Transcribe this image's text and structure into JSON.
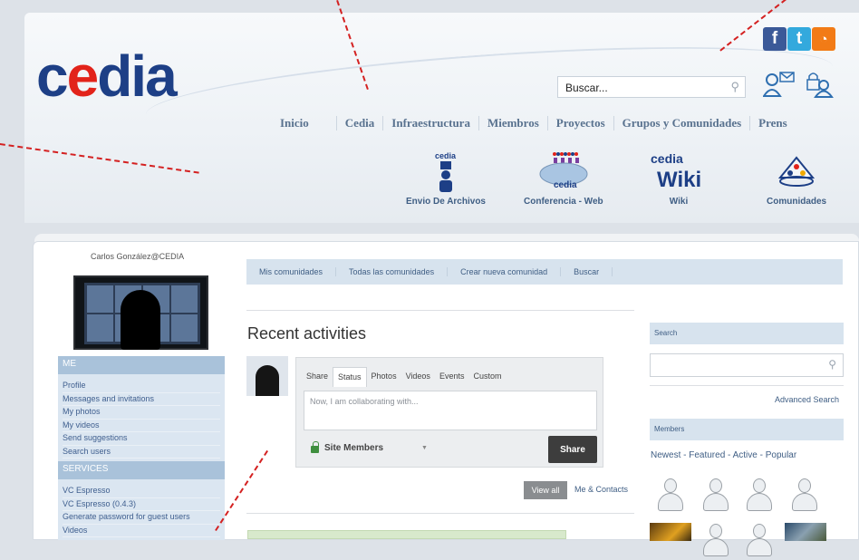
{
  "header": {
    "logo_pre": "c",
    "logo_e": "e",
    "logo_post": "dia",
    "social": [
      {
        "icon": "facebook-icon",
        "glyph": "f"
      },
      {
        "icon": "twitter-icon",
        "glyph": "t"
      },
      {
        "icon": "rss-icon",
        "glyph": "◔"
      }
    ],
    "search_placeholder": "Buscar...",
    "nav": [
      "Inicio",
      "Cedia",
      "Infraestructura",
      "Miembros",
      "Proyectos",
      "Grupos y Comunidades",
      "Prens"
    ]
  },
  "services": [
    {
      "icon": "file-transfer-icon",
      "label": "Envio De Archivos"
    },
    {
      "icon": "web-conference-icon",
      "label": "Conferencia - Web",
      "sub": "cedia"
    },
    {
      "icon": "wiki-icon",
      "label": "Wiki",
      "logo": "cedia",
      "word": "Wiki"
    },
    {
      "icon": "communities-icon",
      "label": "Comunidades"
    }
  ],
  "profile": {
    "username": "Carlos González@CEDIA"
  },
  "sidebar": {
    "me_title": "ME",
    "me_items": [
      "Profile",
      "Messages and invitations",
      "My photos",
      "My videos",
      "Send suggestions",
      "Search users"
    ],
    "services_title": "SERVICES",
    "services_items": [
      "VC Espresso",
      "VC Espresso (0.4.3)",
      "Generate password for guest users",
      "Videos"
    ]
  },
  "community_tabs": [
    "Mis comunidades",
    "Todas las comunidades",
    "Crear nueva comunidad",
    "Buscar"
  ],
  "activity": {
    "title": "Recent activities",
    "share_tabs": [
      "Share",
      "Status",
      "Photos",
      "Videos",
      "Events",
      "Custom"
    ],
    "input_placeholder": "Now, I am collaborating with...",
    "privacy": "Site Members",
    "share_button": "Share",
    "view_all": "View all",
    "me_contacts": "Me & Contacts"
  },
  "right": {
    "search_title": "Search",
    "advanced": "Advanced Search",
    "members_title": "Members",
    "member_filters": "Newest - Featured - Active - Popular"
  }
}
